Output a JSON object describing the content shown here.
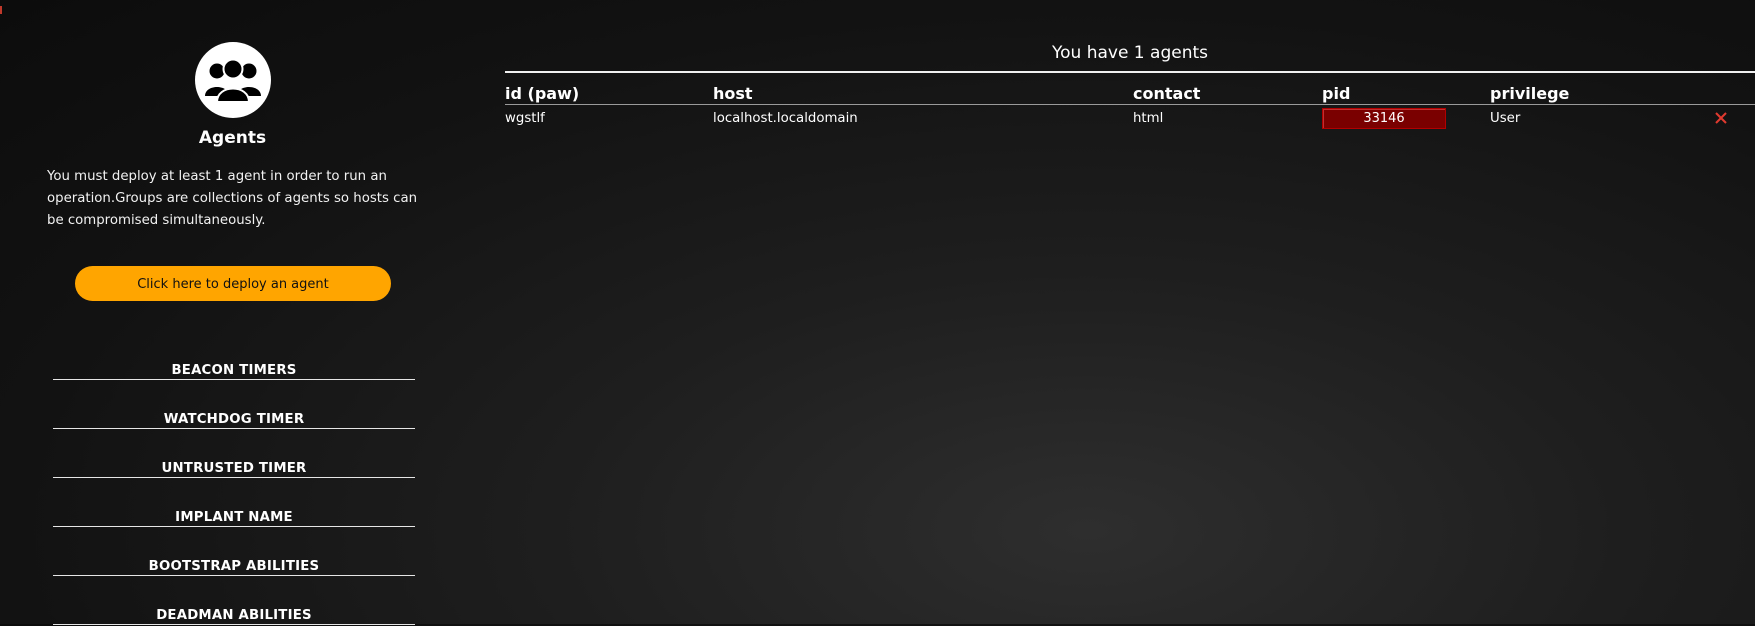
{
  "sidebar": {
    "logo_icon": "group-of-people-icon",
    "title": "Agents",
    "description": "You must deploy at least 1 agent in order to run an operation.Groups are collections of agents so hosts can be compromised simultaneously.",
    "deploy_button": "Click here to deploy an agent",
    "sections": [
      "BEACON TIMERS",
      "WATCHDOG TIMER",
      "UNTRUSTED TIMER",
      "IMPLANT NAME",
      "BOOTSTRAP ABILITIES",
      "DEADMAN ABILITIES"
    ]
  },
  "main": {
    "agent_count_text": "You have 1 agents",
    "columns": [
      "id (paw)",
      "host",
      "contact",
      "pid",
      "privilege"
    ],
    "rows": [
      {
        "paw": "wgstlf",
        "host": "localhost.localdomain",
        "contact": "html",
        "pid": "33146",
        "privilege": "User",
        "delete_icon": "close-x-icon"
      }
    ]
  },
  "colors": {
    "accent": "#ffa500",
    "pid_badge": "#7a0000",
    "delete": "#e03a2f",
    "background": "#141414",
    "text": "#ffffff"
  }
}
